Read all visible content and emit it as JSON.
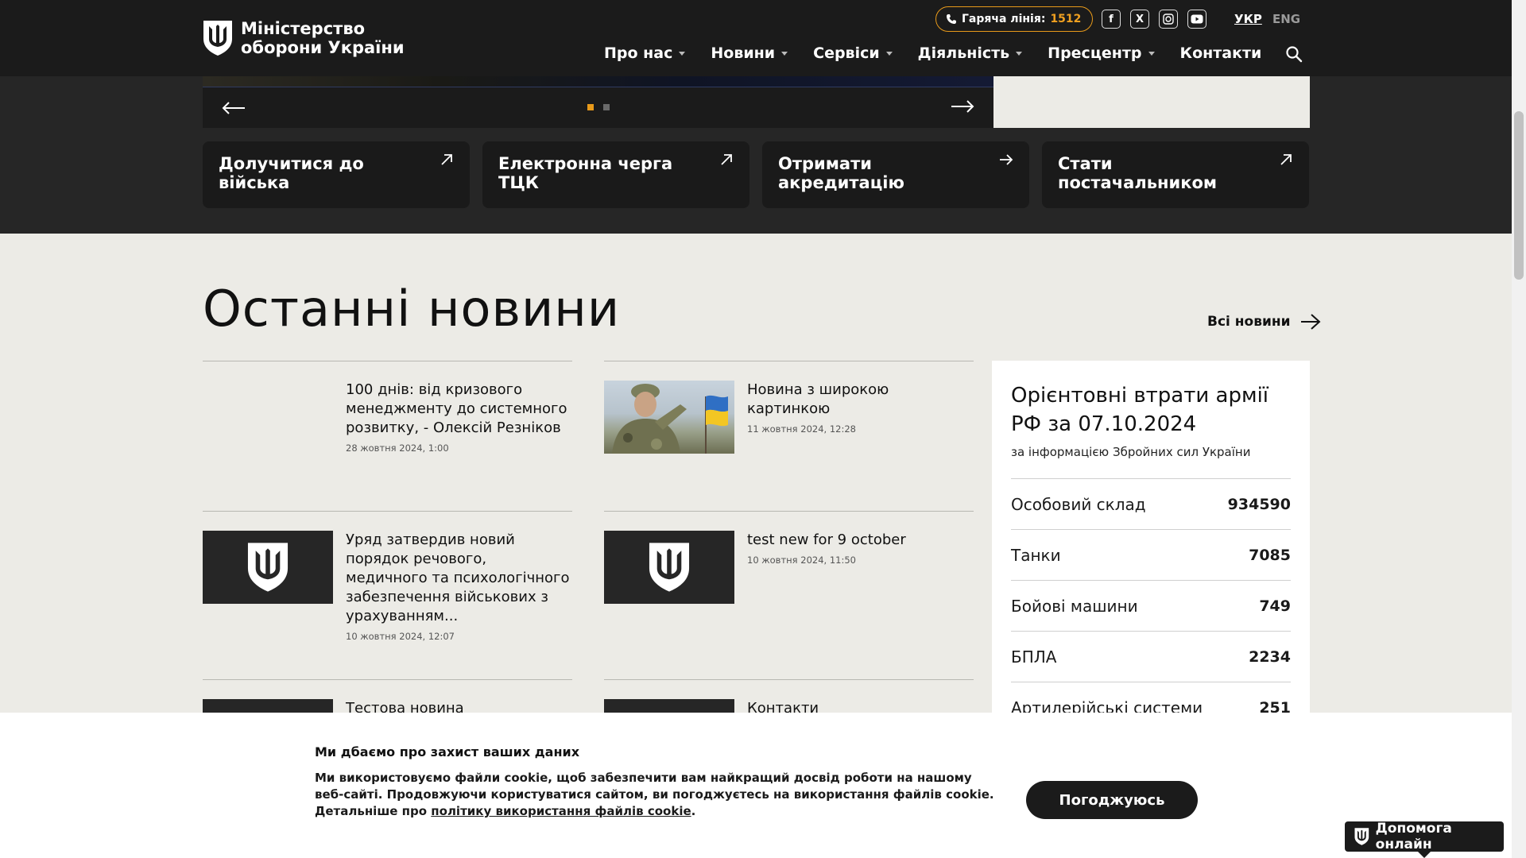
{
  "header": {
    "logo_line1": "Міністерство",
    "logo_line2": "оборони України",
    "hotline_label": "Гаряча лінія:",
    "hotline_number": "1512",
    "socials": [
      "facebook-icon",
      "x-icon",
      "instagram-icon",
      "youtube-icon"
    ],
    "lang_active": "УКР",
    "lang_inactive": "ENG",
    "nav": [
      {
        "label": "Про нас"
      },
      {
        "label": "Новини"
      },
      {
        "label": "Сервіси"
      },
      {
        "label": "Діяльність"
      },
      {
        "label": "Пресцентр"
      },
      {
        "label": "Контакти"
      }
    ]
  },
  "quick_links": [
    {
      "label": "Долучитися до війська"
    },
    {
      "label": "Електронна черга ТЦК"
    },
    {
      "label": "Отримати акредитацію"
    },
    {
      "label": "Стати постачальником"
    }
  ],
  "news": {
    "title": "Останні новини",
    "all_label": "Всі новини",
    "items": [
      {
        "title": "100 днів: від кризового менеджменту до системного розвитку, - Олексій Резніков",
        "date": "28 жовтня 2024, 1:00"
      },
      {
        "title": "Новина з широкою картинкою",
        "date": "11 жовтня 2024, 12:28"
      },
      {
        "title": "Уряд затвердив новий порядок речового, медичного та психологічного забезпечення військових з урахуванням...",
        "date": "10 жовтня 2024, 12:07"
      },
      {
        "title": "test new for 9 october",
        "date": "10 жовтня 2024, 11:50"
      },
      {
        "title": "Тестова новина вирівнювання",
        "date": ""
      },
      {
        "title": "Контакти",
        "date": ""
      }
    ]
  },
  "losses": {
    "title": "Орієнтовні втрати армії РФ за 07.10.2024",
    "subtitle": "за інформацією Збройних сил України",
    "rows": [
      {
        "label": "Особовий склад",
        "value": "934590"
      },
      {
        "label": "Танки",
        "value": "7085"
      },
      {
        "label": "Бойові машини",
        "value": "749"
      },
      {
        "label": "БПЛА",
        "value": "2234"
      },
      {
        "label": "Артилерійські системи",
        "value": "251"
      }
    ]
  },
  "cookie": {
    "title": "Ми дбаємо про захист ваших даних",
    "text": "Ми використовуємо файли cookie, щоб забезпечити вам найкращий досвід роботи на нашому веб-сайті. Продовжуючи користуватися сайтом, ви погоджуєтесь на використання файлів cookie. Детальніше про ",
    "link": "політику використання файлів cookie",
    "text_end": ".",
    "button": "Погоджуюсь"
  },
  "help": {
    "label": "Допомога онлайн"
  },
  "colors": {
    "accent": "#e89a1a",
    "dark": "#1b1b1b",
    "page_bg": "#ecebe6"
  }
}
